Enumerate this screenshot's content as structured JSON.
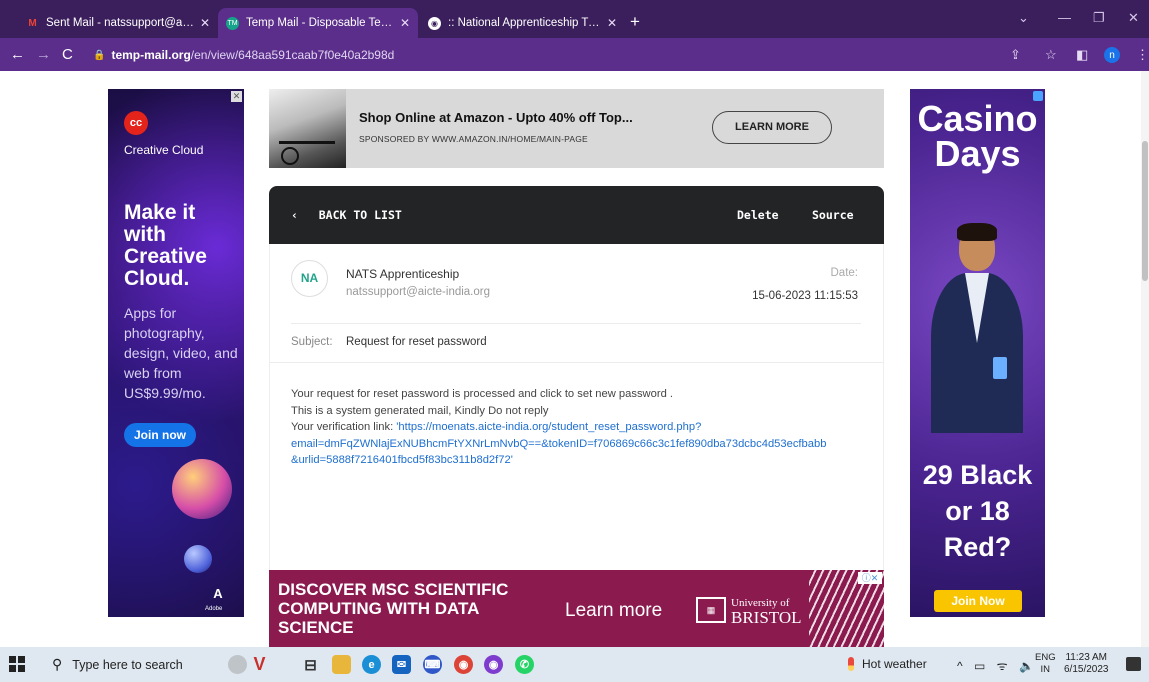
{
  "browser": {
    "tabs": [
      {
        "label": "Sent Mail - natssupport@aicte-in",
        "favicon": "gmail-icon",
        "active": false
      },
      {
        "label": "Temp Mail - Disposable Tempora",
        "favicon": "tempmail-icon",
        "active": true
      },
      {
        "label": ":: National Apprenticeship Trainin",
        "favicon": "nats-icon",
        "active": false
      }
    ],
    "url_host": "temp-mail.org",
    "url_path": "/en/view/648aa591caab7f0e40a2b98d",
    "profile_initial": "n"
  },
  "ads": {
    "left": {
      "brand": "Creative Cloud",
      "headline": "Make it with Creative Cloud.",
      "body": "Apps for photography, design, video, and web from US$9.99/mo.",
      "cta": "Join now",
      "maker": "Adobe"
    },
    "top": {
      "title": "Shop Online at Amazon - Upto 40% off Top...",
      "sponsor": "SPONSORED BY WWW.AMAZON.IN/HOME/MAIN-PAGE",
      "cta": "LEARN MORE"
    },
    "right": {
      "headline": "Casino Days",
      "offer": "29 Black or 18 Red?",
      "cta": "Join Now"
    },
    "bottom": {
      "headline": "DISCOVER MSC SCIENTIFIC COMPUTING WITH DATA SCIENCE",
      "cta": "Learn more",
      "university_line1": "University of",
      "university_line2": "BRISTOL"
    }
  },
  "mail": {
    "toolbar": {
      "back": "BACK TO LIST",
      "delete": "Delete",
      "source": "Source"
    },
    "avatar_initials": "NA",
    "sender_name": "NATS Apprenticeship",
    "sender_email": "natssupport@aicte-india.org",
    "date_label": "Date:",
    "date_value": "15-06-2023 11:15:53",
    "subject_label": "Subject:",
    "subject_value": "Request for reset password",
    "body_line1": "Your request for reset password is processed and click to set new password .",
    "body_line2": "This is a system generated mail, Kindly Do not reply",
    "body_line3_prefix": "Your verification link: ",
    "body_link_line1": "'https://moenats.aicte-india.org/student_reset_password.php?",
    "body_link_line2": "email=dmFqZWNlajExNUBhcmFtYXNrLmNvbQ==&tokenID=f706869c66c3c1fef890dba73dcbc4d53ecfbabb",
    "body_link_line3": "&urlid=5888f7216401fbcd5f83bc311b8d2f72'"
  },
  "taskbar": {
    "search_placeholder": "Type here to search",
    "weather": "Hot weather",
    "lang_line1": "ENG",
    "lang_line2": "IN",
    "time": "11:23 AM",
    "date": "6/15/2023"
  }
}
